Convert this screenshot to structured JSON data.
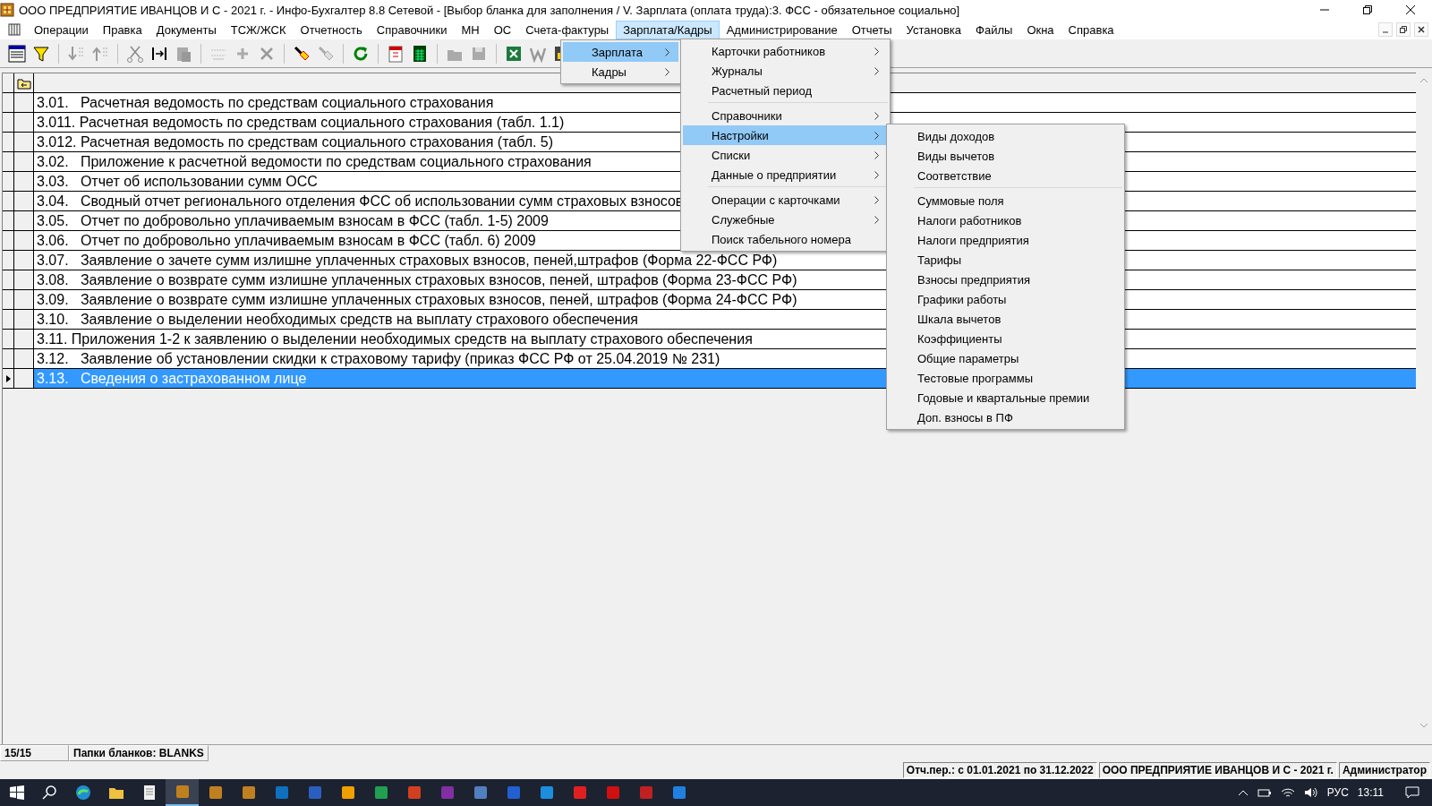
{
  "window": {
    "title": "ООО ПРЕДПРИЯТИЕ ИВАНЦОВ И С - 2021 г. - Инфо-Бухгалтер 8.8 Сетевой - [Выбор бланка для заполнения / V. Зарплата (оплата труда):3. ФСС - обязательное социально]"
  },
  "menubar": [
    {
      "label": "Операции",
      "selected": false
    },
    {
      "label": "Правка",
      "selected": false
    },
    {
      "label": "Документы",
      "selected": false
    },
    {
      "label": "ТСЖ/ЖСК",
      "selected": false
    },
    {
      "label": "Отчетность",
      "selected": false
    },
    {
      "label": "Справочники",
      "selected": false
    },
    {
      "label": "МН",
      "selected": false
    },
    {
      "label": "ОС",
      "selected": false
    },
    {
      "label": "Счета-фактуры",
      "selected": false
    },
    {
      "label": "Зарплата/Кадры",
      "selected": true
    },
    {
      "label": "Администрирование",
      "selected": false
    },
    {
      "label": "Отчеты",
      "selected": false
    },
    {
      "label": "Установка",
      "selected": false
    },
    {
      "label": "Файлы",
      "selected": false
    },
    {
      "label": "Окна",
      "selected": false
    },
    {
      "label": "Справка",
      "selected": false
    }
  ],
  "menus": [
    {
      "items": [
        {
          "kind": "item",
          "label": "Зарплата",
          "submenu": true,
          "selected": true
        },
        {
          "kind": "item",
          "label": "Кадры",
          "submenu": true,
          "selected": false
        }
      ]
    },
    {
      "items": [
        {
          "kind": "item",
          "label": "Карточки работников",
          "submenu": true,
          "selected": false
        },
        {
          "kind": "item",
          "label": "Журналы",
          "submenu": true,
          "selected": false
        },
        {
          "kind": "item",
          "label": "Расчетный период",
          "submenu": false,
          "selected": false
        },
        {
          "kind": "separator"
        },
        {
          "kind": "item",
          "label": "Справочники",
          "submenu": true,
          "selected": false
        },
        {
          "kind": "item",
          "label": "Настройки",
          "submenu": true,
          "selected": true
        },
        {
          "kind": "item",
          "label": "Списки",
          "submenu": true,
          "selected": false
        },
        {
          "kind": "item",
          "label": "Данные о предприятии",
          "submenu": true,
          "selected": false
        },
        {
          "kind": "separator"
        },
        {
          "kind": "item",
          "label": "Операции с карточками",
          "submenu": true,
          "selected": false
        },
        {
          "kind": "item",
          "label": "Служебные",
          "submenu": true,
          "selected": false
        },
        {
          "kind": "item",
          "label": "Поиск табельного номера",
          "submenu": false,
          "selected": false
        }
      ]
    },
    {
      "items": [
        {
          "kind": "item",
          "label": "Виды доходов",
          "submenu": false,
          "selected": false
        },
        {
          "kind": "item",
          "label": "Виды вычетов",
          "submenu": false,
          "selected": false
        },
        {
          "kind": "item",
          "label": "Соответствие",
          "submenu": false,
          "selected": false
        },
        {
          "kind": "separator"
        },
        {
          "kind": "item",
          "label": "Суммовые поля",
          "submenu": false,
          "selected": false
        },
        {
          "kind": "item",
          "label": "Налоги работников",
          "submenu": false,
          "selected": false
        },
        {
          "kind": "item",
          "label": "Налоги предприятия",
          "submenu": false,
          "selected": false
        },
        {
          "kind": "item",
          "label": "Тарифы",
          "submenu": false,
          "selected": false
        },
        {
          "kind": "item",
          "label": "Взносы предприятия",
          "submenu": false,
          "selected": false
        },
        {
          "kind": "item",
          "label": "Графики работы",
          "submenu": false,
          "selected": false
        },
        {
          "kind": "item",
          "label": "Шкала вычетов",
          "submenu": false,
          "selected": false
        },
        {
          "kind": "item",
          "label": "Коэффициенты",
          "submenu": false,
          "selected": false
        },
        {
          "kind": "item",
          "label": "Общие параметры",
          "submenu": false,
          "selected": false
        },
        {
          "kind": "item",
          "label": "Тестовые программы",
          "submenu": false,
          "selected": false
        },
        {
          "kind": "item",
          "label": "Годовые и квартальные премии",
          "submenu": false,
          "selected": false
        },
        {
          "kind": "item",
          "label": "Доп. взносы в ПФ",
          "submenu": false,
          "selected": false
        }
      ]
    }
  ],
  "table": {
    "rows": [
      {
        "text": "3.01.   Расчетная ведомость по средствам социального страхования",
        "selected": false
      },
      {
        "text": "3.011. Расчетная ведомость по средствам социального страхования (табл. 1.1)",
        "selected": false
      },
      {
        "text": "3.012. Расчетная ведомость по средствам социального страхования (табл. 5)",
        "selected": false
      },
      {
        "text": "3.02.   Приложение к расчетной ведомости по средствам социального страхования",
        "selected": false
      },
      {
        "text": "3.03.   Отчет об использовании сумм ОСС",
        "selected": false
      },
      {
        "text": "3.04.   Сводный отчет регионального отделения ФСС об использовании сумм страховых взносов",
        "selected": false
      },
      {
        "text": "3.05.   Отчет по добровольно уплачиваемым взносам в ФСС (табл. 1-5) 2009",
        "selected": false
      },
      {
        "text": "3.06.   Отчет по добровольно уплачиваемым взносам в ФСС (табл. 6) 2009",
        "selected": false
      },
      {
        "text": "3.07.   Заявление о зачете сумм излишне уплаченных страховых взносов, пеней,штрафов (Форма 22-ФСС РФ)",
        "selected": false
      },
      {
        "text": "3.08.   Заявление о возврате сумм излишне уплаченных страховых взносов, пеней, штрафов (Форма 23-ФСС РФ)",
        "selected": false
      },
      {
        "text": "3.09.   Заявление о возврате сумм излишне уплаченных страховых взносов, пеней, штрафов (Форма 24-ФСС РФ)",
        "selected": false
      },
      {
        "text": "3.10.   Заявление о выделении необходимых средств на выплату страхового обеспечения",
        "selected": false
      },
      {
        "text": "3.11. Приложения 1-2 к заявлению о выделении необходимых средств на выплату страхового обеспечения",
        "selected": false
      },
      {
        "text": "3.12.   Заявление об установлении скидки к страховому тарифу (приказ ФСС РФ от 25.04.2019 № 231)",
        "selected": false
      },
      {
        "text": "3.13.   Сведения о застрахованном лице",
        "selected": true
      }
    ]
  },
  "status_bar": {
    "count": "15/15",
    "folders": "Папки бланков: BLANKS"
  },
  "info_bar": [
    "Отч.пер.: с 01.01.2021 по 31.12.2022",
    "ООО ПРЕДПРИЯТИЕ ИВАНЦОВ И С - 2021 г.",
    "Администратор"
  ],
  "taskbar": {
    "language": "РУС",
    "time": "13:11"
  }
}
